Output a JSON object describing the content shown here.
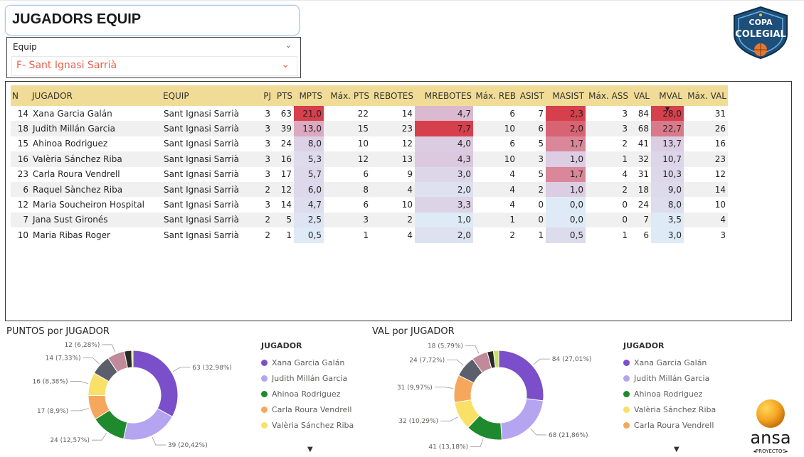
{
  "page": {
    "title": "JUGADORS EQUIP"
  },
  "slicer": {
    "label": "Equip",
    "value": "F- Sant Ignasi Sarrià"
  },
  "logo_copa": {
    "line1": "COPA",
    "line2": "COLEGIAL",
    "icon": "copa-colegial-logo"
  },
  "logo_ansa": {
    "word": "ansa",
    "sub": "◂PROYECTOS▸",
    "icon": "ansa-proyectos-logo"
  },
  "table": {
    "columns": [
      "N",
      "JUGADOR",
      "EQUIP",
      "PJ",
      "PTS",
      "MPTS",
      "Máx. PTS",
      "REBOTES",
      "MREBOTES",
      "Máx. REB",
      "ASIST",
      "MASIST",
      "Máx. ASS",
      "VAL",
      "MVAL",
      "Máx. VAL"
    ],
    "sorted_column": "MVAL",
    "rows": [
      {
        "n": "14",
        "jugador": "Xana Garcia Galán",
        "equip": "Sant Ignasi Sarrià",
        "pj": "3",
        "pts": "63",
        "mpts": "21,0",
        "maxpts": "22",
        "rebotes": "14",
        "mrebotes": "4,7",
        "maxreb": "6",
        "asist": "7",
        "masist": "2,3",
        "maxass": "3",
        "val": "84",
        "mval": "28,0",
        "maxval": "31"
      },
      {
        "n": "18",
        "jugador": "Judith Millán Garcia",
        "equip": "Sant Ignasi Sarrià",
        "pj": "3",
        "pts": "39",
        "mpts": "13,0",
        "maxpts": "15",
        "rebotes": "23",
        "mrebotes": "7,7",
        "maxreb": "10",
        "asist": "6",
        "masist": "2,0",
        "maxass": "3",
        "val": "68",
        "mval": "22,7",
        "maxval": "26"
      },
      {
        "n": "15",
        "jugador": "Ahinoa Rodriguez",
        "equip": "Sant Ignasi Sarrià",
        "pj": "3",
        "pts": "24",
        "mpts": "8,0",
        "maxpts": "10",
        "rebotes": "12",
        "mrebotes": "4,0",
        "maxreb": "6",
        "asist": "5",
        "masist": "1,7",
        "maxass": "2",
        "val": "41",
        "mval": "13,7",
        "maxval": "16"
      },
      {
        "n": "16",
        "jugador": "Valèria Sánchez Riba",
        "equip": "Sant Ignasi Sarrià",
        "pj": "3",
        "pts": "16",
        "mpts": "5,3",
        "maxpts": "12",
        "rebotes": "13",
        "mrebotes": "4,3",
        "maxreb": "10",
        "asist": "3",
        "masist": "1,0",
        "maxass": "1",
        "val": "32",
        "mval": "10,7",
        "maxval": "23"
      },
      {
        "n": "23",
        "jugador": "Carla Roura Vendrell",
        "equip": "Sant Ignasi Sarrià",
        "pj": "3",
        "pts": "17",
        "mpts": "5,7",
        "maxpts": "6",
        "rebotes": "9",
        "mrebotes": "3,0",
        "maxreb": "4",
        "asist": "5",
        "masist": "1,7",
        "maxass": "4",
        "val": "31",
        "mval": "10,3",
        "maxval": "12"
      },
      {
        "n": "6",
        "jugador": "Raquel Sànchez Riba",
        "equip": "Sant Ignasi Sarrià",
        "pj": "2",
        "pts": "12",
        "mpts": "6,0",
        "maxpts": "8",
        "rebotes": "4",
        "mrebotes": "2,0",
        "maxreb": "4",
        "asist": "2",
        "masist": "1,0",
        "maxass": "2",
        "val": "18",
        "mval": "9,0",
        "maxval": "14"
      },
      {
        "n": "12",
        "jugador": "Maria Soucheiron Hospital",
        "equip": "Sant Ignasi Sarrià",
        "pj": "3",
        "pts": "14",
        "mpts": "4,7",
        "maxpts": "6",
        "rebotes": "10",
        "mrebotes": "3,3",
        "maxreb": "4",
        "asist": "0",
        "masist": "0,0",
        "maxass": "0",
        "val": "24",
        "mval": "8,0",
        "maxval": "10"
      },
      {
        "n": "7",
        "jugador": "Jana Sust Gironés",
        "equip": "Sant Ignasi Sarrià",
        "pj": "2",
        "pts": "5",
        "mpts": "2,5",
        "maxpts": "3",
        "rebotes": "2",
        "mrebotes": "1,0",
        "maxreb": "1",
        "asist": "0",
        "masist": "0,0",
        "maxass": "0",
        "val": "7",
        "mval": "3,5",
        "maxval": "4"
      },
      {
        "n": "10",
        "jugador": "Maria Ribas Roger",
        "equip": "Sant Ignasi Sarrià",
        "pj": "2",
        "pts": "1",
        "mpts": "0,5",
        "maxpts": "1",
        "rebotes": "4",
        "mrebotes": "2,0",
        "maxreb": "2",
        "asist": "1",
        "masist": "0,5",
        "maxass": "1",
        "val": "6",
        "mval": "3,0",
        "maxval": "3"
      }
    ]
  },
  "colors": {
    "header_bg": "#f0dc96",
    "scale_high": "#d6404c",
    "scale_mid": "#dcc8e0",
    "scale_low": "#deebf7",
    "slicer_value": "#e8624c"
  },
  "chart_data": [
    {
      "type": "pie",
      "title": "PUNTOS por JUGADOR",
      "legend_title": "JUGADOR",
      "legend_placement": "right",
      "slices": [
        {
          "label": "Xana Garcia Galán",
          "value": 63,
          "text": "63 (32,98%)",
          "color": "#7b4fc9"
        },
        {
          "label": "Judith Millán Garcia",
          "value": 39,
          "text": "39 (20,42%)",
          "color": "#b5a4f0"
        },
        {
          "label": "Ahinoa Rodriguez",
          "value": 24,
          "text": "24 (12,57%)",
          "color": "#1f8a2d"
        },
        {
          "label": "Carla Roura Vendrell",
          "value": 17,
          "text": "17 (8,9%)",
          "color": "#f5a75c"
        },
        {
          "label": "Valèria Sánchez Riba",
          "value": 16,
          "text": "16 (8,38%)",
          "color": "#f9e066"
        },
        {
          "label": "Maria Soucheiron Hospital",
          "value": 14,
          "text": "14 (7,33%)",
          "color": "#5a5f6b"
        },
        {
          "label": "Raquel Sànchez Riba",
          "value": 12,
          "text": "12 (6,28%)",
          "color": "#c08a9a"
        },
        {
          "label": "Jana Sust Gironés",
          "value": 5,
          "text": "",
          "color": "#2a2a2a"
        },
        {
          "label": "Maria Ribas Roger",
          "value": 1,
          "text": "",
          "color": "#c9e265"
        }
      ],
      "legend": [
        "Xana Garcia Galán",
        "Judith Millán Garcia",
        "Ahinoa Rodriguez",
        "Carla Roura Vendrell",
        "Valèria Sánchez Riba"
      ]
    },
    {
      "type": "pie",
      "title": "VAL por JUGADOR",
      "legend_title": "JUGADOR",
      "legend_placement": "right",
      "slices": [
        {
          "label": "Xana Garcia Galán",
          "value": 84,
          "text": "84 (27,01%)",
          "color": "#7b4fc9"
        },
        {
          "label": "Judith Millán Garcia",
          "value": 68,
          "text": "68 (21,86%)",
          "color": "#b5a4f0"
        },
        {
          "label": "Ahinoa Rodriguez",
          "value": 41,
          "text": "41 (13,18%)",
          "color": "#1f8a2d"
        },
        {
          "label": "Valèria Sánchez Riba",
          "value": 32,
          "text": "32 (10,29%)",
          "color": "#f9e066"
        },
        {
          "label": "Carla Roura Vendrell",
          "value": 31,
          "text": "31 (9,97%)",
          "color": "#f5a75c"
        },
        {
          "label": "Maria Soucheiron Hospital",
          "value": 24,
          "text": "24 (7,72%)",
          "color": "#5a5f6b"
        },
        {
          "label": "Raquel Sànchez Riba",
          "value": 18,
          "text": "18 (5,79%)",
          "color": "#c08a9a"
        },
        {
          "label": "Jana Sust Gironés",
          "value": 7,
          "text": "",
          "color": "#2a2a2a"
        },
        {
          "label": "Maria Ribas Roger",
          "value": 6,
          "text": "",
          "color": "#c9e265"
        }
      ],
      "legend": [
        "Xana Garcia Galán",
        "Judith Millán Garcia",
        "Ahinoa Rodriguez",
        "Valèria Sánchez Riba",
        "Carla Roura Vendrell"
      ]
    }
  ]
}
